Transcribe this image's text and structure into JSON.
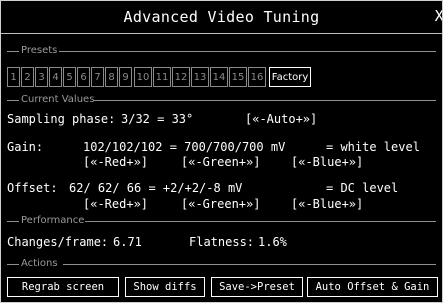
{
  "window": {
    "title": "Advanced Video Tuning",
    "close_glyph": "X"
  },
  "presets": {
    "legend": "Presets",
    "buttons": [
      "1",
      "2",
      "3",
      "4",
      "5",
      "6",
      "7",
      "8",
      "9",
      "10",
      "11",
      "12",
      "13",
      "14",
      "15",
      "16"
    ],
    "factory_label": "Factory"
  },
  "current_values": {
    "legend": "Current Values",
    "sampling": {
      "label": "Sampling phase:",
      "value": "3/32 = 33°",
      "control": "[«-Auto+»]"
    },
    "gain": {
      "label": "Gain:",
      "value": "102/102/102 = 700/700/700 mV",
      "note": "= white level",
      "red": "[«-Red+»]",
      "green": "[«-Green+»]",
      "blue": "[«-Blue+»]"
    },
    "offset": {
      "label": "Offset:",
      "value": "62/ 62/ 66 = +2/+2/-8 mV",
      "note": "= DC level",
      "red": "[«-Red+»]",
      "green": "[«-Green+»]",
      "blue": "[«-Blue+»]"
    }
  },
  "performance": {
    "legend": "Performance",
    "changes_label": "Changes/frame:",
    "changes_value": "6.71",
    "flatness_label": "Flatness:",
    "flatness_value": "1.6%"
  },
  "actions": {
    "legend": "Actions",
    "regrab": "Regrab screen",
    "show_diffs": "Show diffs",
    "save_preset": "Save->Preset",
    "auto_offset_gain": "Auto Offset & Gain"
  }
}
